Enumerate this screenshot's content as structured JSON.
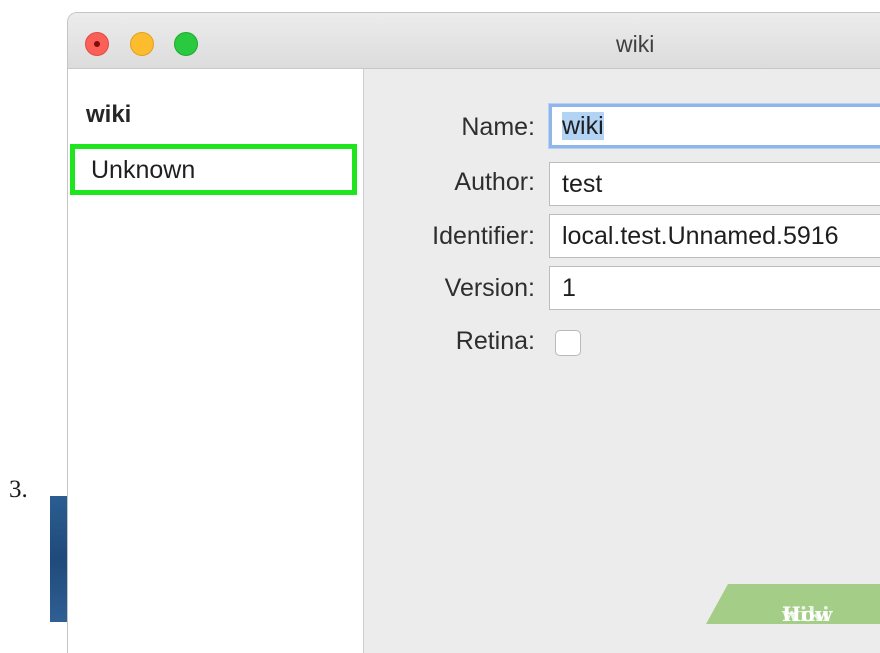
{
  "step_number": "3.",
  "window": {
    "title": "wiki",
    "traffic_lights": {
      "close": "close-button",
      "minimize": "minimize-button",
      "zoom": "zoom-button"
    }
  },
  "sidebar": {
    "header": "wiki",
    "items": [
      {
        "label": "Unknown",
        "highlighted": true,
        "highlight_color": "#1ee51e"
      }
    ]
  },
  "form": {
    "name": {
      "label": "Name:",
      "value": "wiki"
    },
    "author": {
      "label": "Author:",
      "value": "test"
    },
    "identifier": {
      "label": "Identifier:",
      "value": "local.test.Unnamed.5916"
    },
    "version": {
      "label": "Version:",
      "value": "1"
    },
    "retina": {
      "label": "Retina:",
      "checked": false
    }
  },
  "watermark": {
    "wiki": "wiki",
    "how": "How"
  },
  "colors": {
    "focus_ring": "#8fb6ea",
    "selection": "#b3d3f5",
    "highlight_box": "#1ee51e"
  }
}
